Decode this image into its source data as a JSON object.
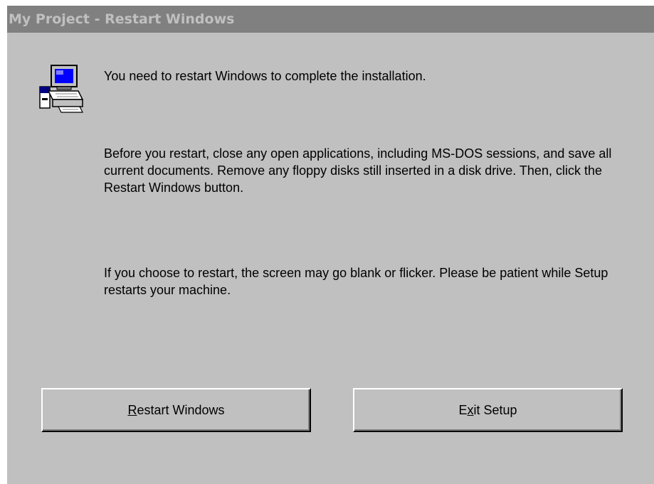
{
  "window": {
    "title": "My Project - Restart Windows"
  },
  "icon": {
    "name": "computer-setup-icon"
  },
  "message": {
    "line1": "You need to restart Windows to complete the installation.",
    "line2": "Before you restart, close any open applications, including MS-DOS sessions, and save all current documents. Remove any floppy disks still inserted in a disk drive. Then, click the Restart Windows button.",
    "line3": "If you choose to restart, the screen may go blank or flicker.  Please be patient while Setup restarts your machine."
  },
  "buttons": {
    "restart": {
      "mnemonic": "R",
      "rest": "estart Windows"
    },
    "exit": {
      "before": "E",
      "mnemonic": "x",
      "rest": "it Setup"
    }
  },
  "colors": {
    "face": "#c0c0c0",
    "titlebar_inactive": "#808080",
    "text": "#000000"
  }
}
